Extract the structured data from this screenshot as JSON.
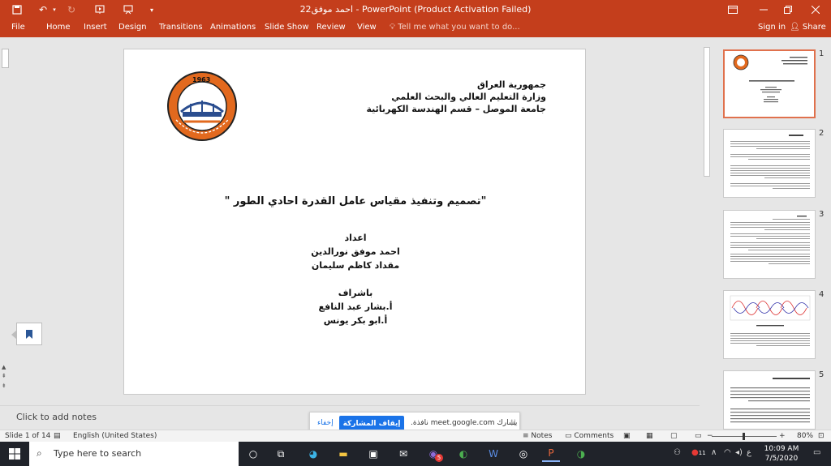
{
  "titlebar": {
    "title": "احمد موفق22 - PowerPoint (Product Activation Failed)",
    "minimize_icon": "minimize-icon",
    "restore_icon": "restore-icon",
    "close_icon": "close-icon",
    "accent": "#c43e1c"
  },
  "ribbon": {
    "tabs": [
      "File",
      "Home",
      "Insert",
      "Design",
      "Transitions",
      "Animations",
      "Slide Show",
      "Review",
      "View"
    ],
    "tell_me": "Tell me what you want to do...",
    "sign_in": "Sign in",
    "share": "Share"
  },
  "slide": {
    "header_lines": [
      "جمهورية العراق",
      "وزارة التعليم العالي والبحث العلمي",
      "جامعة الموصل – قسم الهندسة الكهربائية"
    ],
    "title": "\"تصميم وتنفيذ مقياس عامل القدرة احادي الطور \"",
    "prepared_label": "اعداد",
    "authors": [
      "احمد موفق نورالدين",
      "مقداد كاظم سليمان"
    ],
    "supervision_label": "باشراف",
    "supervisors": [
      "أ.بشار عبد النافع",
      "أ.ابو بكر يونس"
    ],
    "logo": {
      "year": "1963"
    }
  },
  "thumbnails": {
    "numbers": [
      "1",
      "2",
      "3",
      "4",
      "5"
    ],
    "selected": 1,
    "selected_color": "#e0714d"
  },
  "notes": {
    "placeholder": "Click to add notes"
  },
  "meet_banner": {
    "message": "يشارك meet.google.com نافذة.",
    "stop_button": "إيقاف المشاركة",
    "hide_link": "إخفاء"
  },
  "statusbar": {
    "slide_info": "Slide 1 of 14",
    "language": "English (United States)",
    "notes": "Notes",
    "comments": "Comments",
    "zoom": "80%"
  },
  "taskbar": {
    "search_placeholder": "Type here to search",
    "time": "10:09 AM",
    "date": "7/5/2020",
    "lang_indicator": "ع",
    "viber_badge": "5",
    "notification_badge": "11"
  }
}
